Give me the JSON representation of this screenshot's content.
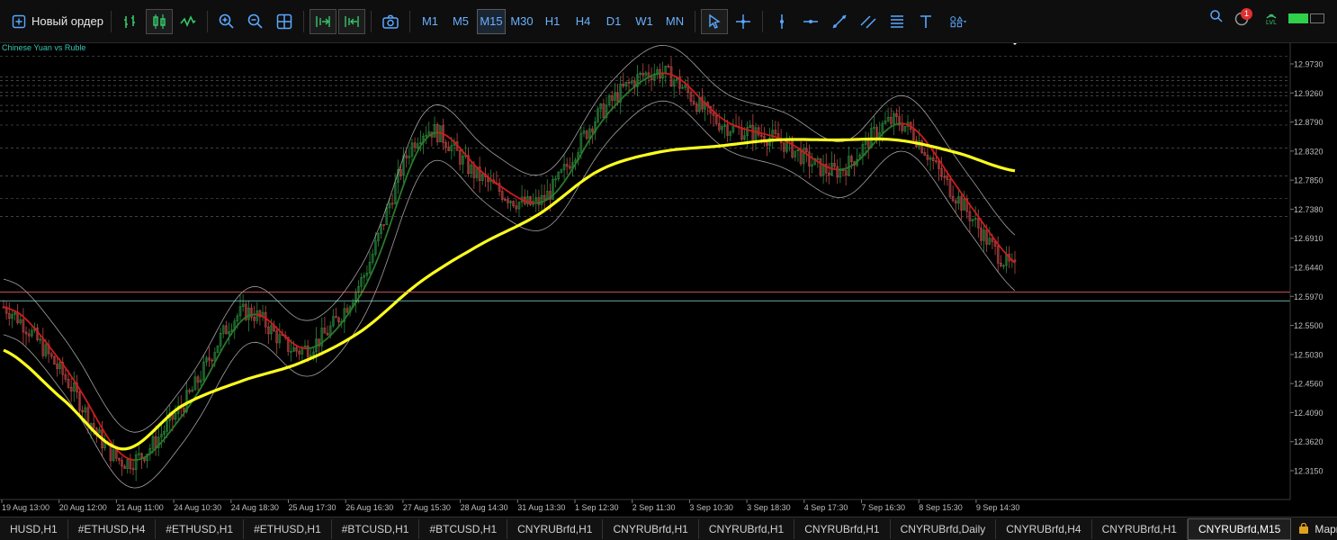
{
  "toolbar": {
    "new_order_label": "Новый ордер",
    "timeframes": [
      "M1",
      "M5",
      "M15",
      "M30",
      "H1",
      "H4",
      "D1",
      "W1",
      "MN"
    ],
    "active_timeframe": "M15",
    "notification_count": "1",
    "lvl_label": "LVL"
  },
  "chart": {
    "instrument_label": "Chinese Yuan vs Ruble",
    "price_levels": [
      "12.9730",
      "12.9260",
      "12.8790",
      "12.8320",
      "12.7850",
      "12.7380",
      "12.6910",
      "12.6440",
      "12.5970",
      "12.5500",
      "12.5030",
      "12.4560",
      "12.4090",
      "12.3620",
      "12.3150"
    ],
    "bid_price": "12.6038",
    "ask_price": "12.5898",
    "time_labels": [
      "19 Aug 13:00",
      "20 Aug 12:00",
      "21 Aug 11:00",
      "24 Aug 10:30",
      "24 Aug 18:30",
      "25 Aug 17:30",
      "26 Aug 16:30",
      "27 Aug 15:30",
      "28 Aug 14:30",
      "31 Aug 13:30",
      "1 Sep 12:30",
      "2 Sep 11:30",
      "3 Sep 10:30",
      "3 Sep 18:30",
      "4 Sep 17:30",
      "7 Sep 16:30",
      "8 Sep 15:30",
      "9 Sep 14:30"
    ],
    "colors": {
      "background": "#000000",
      "bull": "#2a8a3c",
      "bear": "#c04848",
      "ma_slow": "#ffff1e",
      "ma_mid_up": "#2a7a2a",
      "ma_mid_down": "#d01c1c",
      "band": "#bdbdbd",
      "bid_line": "#ff6a6a",
      "ask_line": "#8be0d6"
    }
  },
  "chart_data": {
    "type": "candlestick",
    "title": "Chinese Yuan vs Ruble",
    "ylim": [
      12.28,
      13.0
    ],
    "x": [
      "19 Aug 13:00",
      "20 Aug 12:00",
      "21 Aug 11:00",
      "24 Aug 10:30",
      "24 Aug 18:30",
      "25 Aug 17:30",
      "26 Aug 16:30",
      "27 Aug 15:30",
      "28 Aug 14:30",
      "31 Aug 13:30",
      "1 Sep 12:30",
      "2 Sep 11:30",
      "3 Sep 10:30",
      "3 Sep 18:30",
      "4 Sep 17:30",
      "7 Sep 16:30",
      "8 Sep 15:30",
      "9 Sep 14:30"
    ],
    "series": [
      {
        "name": "",
        "values": [
          12.58,
          12.47,
          12.33,
          12.42,
          12.57,
          12.51,
          12.62,
          12.86,
          12.79,
          12.75,
          12.89,
          12.96,
          12.88,
          12.85,
          12.8,
          12.88,
          12.76,
          12.64
        ]
      },
      {
        "name": "",
        "values": [
          12.51,
          12.43,
          12.35,
          12.42,
          12.46,
          12.49,
          12.54,
          12.62,
          12.68,
          12.73,
          12.8,
          12.83,
          12.84,
          12.85,
          12.85,
          12.85,
          12.83,
          12.8
        ]
      }
    ],
    "grid": false
  },
  "tabs": [
    "HUSD,H1",
    "#ETHUSD,H4",
    "#ETHUSD,H1",
    "#ETHUSD,H1",
    "#BTCUSD,H1",
    "#BTCUSD,H1",
    "CNYRUBrfd,H1",
    "CNYRUBrfd,H1",
    "CNYRUBrfd,H1",
    "CNYRUBrfd,H1",
    "CNYRUBrfd,Daily",
    "CNYRUBrfd,H4",
    "CNYRUBrfd,H1",
    "CNYRUBrfd,M15"
  ],
  "active_tab": "CNYRUBrfd,M15",
  "market_label": "Маркет"
}
